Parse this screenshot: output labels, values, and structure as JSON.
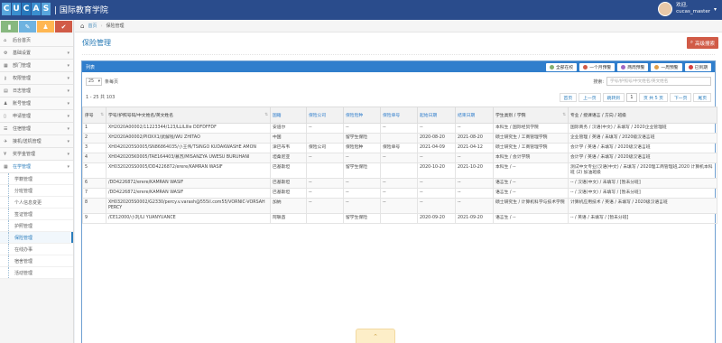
{
  "header": {
    "logo_letters": [
      "C",
      "U",
      "C",
      "A",
      "S"
    ],
    "app_title": "国际教育学院",
    "user_greeting": "欢迎,",
    "username": "cucas_master"
  },
  "sidebar": {
    "items": [
      {
        "icon": "home-icon",
        "glyph": "⌂",
        "label": "后台首页"
      },
      {
        "icon": "gear-icon",
        "glyph": "⚙",
        "label": "基础设置"
      },
      {
        "icon": "building-icon",
        "glyph": "▦",
        "label": "部门管理"
      },
      {
        "icon": "key-icon",
        "glyph": "⚷",
        "label": "权限管理"
      },
      {
        "icon": "calendar-icon",
        "glyph": "▤",
        "label": "日志管理"
      },
      {
        "icon": "user-icon",
        "glyph": "♟",
        "label": "账号管理"
      },
      {
        "icon": "file-icon",
        "glyph": "▯",
        "label": "申请管理"
      },
      {
        "icon": "list-icon",
        "glyph": "☰",
        "label": "住宿管理"
      },
      {
        "icon": "plane-icon",
        "glyph": "✈",
        "label": "接机/送机管理"
      },
      {
        "icon": "money-icon",
        "glyph": "¥",
        "label": "奖学金管理"
      }
    ],
    "open_item": {
      "icon": "grid-icon",
      "glyph": "▦",
      "label": "在学管理"
    },
    "sub_items": [
      "学籍管理",
      "分班管理",
      "个人信息变更",
      "签证管理",
      "护照管理",
      "保险管理",
      "在线办事",
      "宿舍管理",
      "活动管理"
    ],
    "active_sub": "保险管理"
  },
  "breadcrumb": {
    "home": "首页",
    "current": "保险管理"
  },
  "page": {
    "title": "保险管理",
    "adv_search": "高级搜索"
  },
  "panel": {
    "title": "列表",
    "legend": [
      {
        "label": "全部在校",
        "color": "#82af6f"
      },
      {
        "label": "一个月预警",
        "color": "#d15b47"
      },
      {
        "label": "两周预警",
        "color": "#a069c3"
      },
      {
        "label": "一周预警",
        "color": "#e09e48"
      },
      {
        "label": "已到期",
        "color": "#d53f40"
      }
    ]
  },
  "toolbar": {
    "page_size": "25",
    "page_size_suffix": "条每页",
    "search_label": "搜索:",
    "search_placeholder": "学号/护照号/中文姓名/英文姓名"
  },
  "pager": {
    "records": "1 - 25 共 103",
    "first": "首页",
    "prev": "上一页",
    "jump": "跳转到",
    "page_input": "1",
    "page_info": "页 共 5 页",
    "next": "下一页",
    "last": "尾页"
  },
  "table": {
    "columns": [
      "序号",
      "学号/护照号码/中文姓名/英文姓名",
      "国籍",
      "保险公司",
      "保险险种",
      "保险单号",
      "起始日期",
      "结束日期",
      "学生类别 / 学院",
      "专业 / 授课语言 / 方向 / 班级"
    ],
    "rows": [
      [
        "1",
        "XH2020A00002/11223344/123/LLILIlle DDFDFFDF",
        "安道尔",
        "--",
        "--",
        "--",
        "--",
        "--",
        "本科生 / 国际经贸学院",
        "国际商务 / 汉语(中文) / 未填写 / 2020企业管理班"
      ],
      [
        "2",
        "XH2020A00002/PIOXX1/武解钱/WU ZHITAO",
        "中国",
        "",
        "留学生保险",
        "",
        "2020-08-20",
        "2021-08-20",
        "硕士研究生 / 工商管理学院",
        "企业管理 / 英语 / 未填写 / 2020级汉语言班"
      ],
      [
        "3",
        "XH0420205S0005/SN86864035/小王伟/TSINGO KUDAKWASHE AMON",
        "津巴布韦",
        "保险公司",
        "保险险种",
        "保险单号",
        "2021-04-09",
        "2021-04-12",
        "硕士研究生 / 工商管理学院",
        "会计学 / 英语 / 未填写 / 2020级汉语言班"
      ],
      [
        "4",
        "XH0420205K0005/TAE164403/慕苏/MISANZYA UWESU BURUHANI",
        "坦桑尼亚",
        "--",
        "--",
        "--",
        "--",
        "--",
        "本科生 / 会计学院",
        "会计学 / 英语 / 未填写 / 2020级汉语言班"
      ],
      [
        "5",
        "XH032020SS0005/DD4226872/erere/KAMRAN WASIF",
        "巴基斯坦",
        "",
        "留学生保险",
        "",
        "2020-10-20",
        "2021-10-20",
        "本科生 / --",
        "测试中文专业(汉语(中文) / 未填写 / 2020理工商管理班,2020 计算机本科班 (2) 加油班级"
      ],
      [
        "6",
        "/DD4226872/erere/KAMRAN WASIF",
        "巴基斯坦",
        "--",
        "--",
        "--",
        "--",
        "--",
        "语言生 / --",
        "-- / 汉语(中文) / 未填写 / [暂未分班]"
      ],
      [
        "7",
        "/DD4226872/erere/KAMRAN WASIF",
        "巴基斯坦",
        "--",
        "--",
        "--",
        "--",
        "--",
        "语言生 / --",
        "-- / 汉语(中文) / 未填写 / [暂未分班]"
      ],
      [
        "8",
        "XH0320205S0002/G2330/percy.v.varash@555il.com55/VORNIC-VORSAH PERCY",
        "加纳",
        "--",
        "--",
        "--",
        "--",
        "--",
        "硕士研究生 / 计算机科学与技术学院",
        "计算机应用技术 / 英语 / 未填写 / 2020级汉语言班"
      ],
      [
        "9",
        "/CE12000/小刘/LI YUANYUANCE",
        "阿联酋",
        "",
        "留学生保险",
        "",
        "2020-09-20",
        "2021-09-20",
        "语言生 / --",
        "-- / 英语 / 未填写 / [暂未分班]"
      ]
    ]
  }
}
